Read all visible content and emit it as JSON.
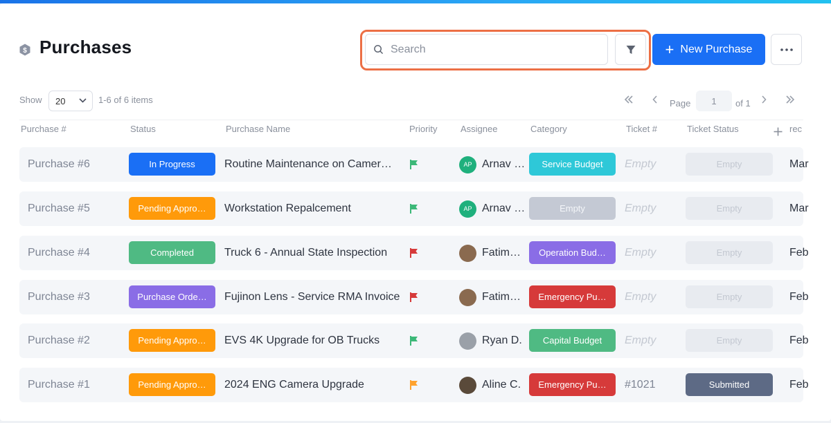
{
  "header": {
    "title": "Purchases",
    "title_icon": "dollar-hexagon-icon",
    "search_placeholder": "Search",
    "new_button_label": "New Purchase",
    "accent_color": "#1a6ff5",
    "highlight_color": "#ec6f45"
  },
  "pagination": {
    "show_label": "Show",
    "page_size": "20",
    "items_count": "1-6 of 6 items",
    "page_label": "Page",
    "current_page": "1",
    "of_label": "of 1"
  },
  "columns": [
    "Purchase #",
    "Status",
    "Purchase Name",
    "Priority",
    "Assignee",
    "Category",
    "Ticket #",
    "Ticket Status",
    "rec"
  ],
  "rows": [
    {
      "number": "Purchase #6",
      "status": "In Progress",
      "status_color": "#1a6ff5",
      "name": "Routine Maintenance on Camer…",
      "priority_color": "#3cb878",
      "avatar": "AP",
      "avatar_color": "#1fb07d",
      "assignee": "Arnav …",
      "category": "Service Budget",
      "category_color": "#2ec8d8",
      "ticket": "Empty",
      "ticket_status": "Empty",
      "last": "Mar"
    },
    {
      "number": "Purchase #5",
      "status": "Pending Appro…",
      "status_color": "#ff9a0a",
      "name": "Workstation Repalcement",
      "priority_color": "#3cb878",
      "avatar": "AP",
      "avatar_color": "#1fb07d",
      "assignee": "Arnav …",
      "category": "Empty",
      "category_color": "#c4c9d4",
      "ticket": "Empty",
      "ticket_status": "Empty",
      "last": "Mar"
    },
    {
      "number": "Purchase #4",
      "status": "Completed",
      "status_color": "#4fba83",
      "name": "Truck 6 - Annual State Inspection",
      "priority_color": "#d63a3a",
      "avatar": "",
      "avatar_color": "#8a6a4f",
      "assignee": "Fatim…",
      "category": "Operation Bud…",
      "category_color": "#8a6de6",
      "ticket": "Empty",
      "ticket_status": "Empty",
      "last": "Feb"
    },
    {
      "number": "Purchase #3",
      "status": "Purchase Orde…",
      "status_color": "#8a6de6",
      "name": "Fujinon Lens - Service RMA Invoice",
      "priority_color": "#d63a3a",
      "avatar": "",
      "avatar_color": "#8a6a4f",
      "assignee": "Fatim…",
      "category": "Emergency Pu…",
      "category_color": "#d63a3a",
      "ticket": "Empty",
      "ticket_status": "Empty",
      "last": "Feb"
    },
    {
      "number": "Purchase #2",
      "status": "Pending Appro…",
      "status_color": "#ff9a0a",
      "name": "EVS 4K Upgrade for OB Trucks",
      "priority_color": "#3cb878",
      "avatar": "",
      "avatar_color": "#9aa0a8",
      "assignee": "Ryan D.",
      "category": "Capital Budget",
      "category_color": "#4fba83",
      "ticket": "Empty",
      "ticket_status": "Empty",
      "last": "Feb"
    },
    {
      "number": "Purchase #1",
      "status": "Pending Appro…",
      "status_color": "#ff9a0a",
      "name": "2024 ENG Camera Upgrade",
      "priority_color": "#ffa22e",
      "avatar": "",
      "avatar_color": "#5a4a3a",
      "assignee": "Aline C.",
      "category": "Emergency Pu…",
      "category_color": "#d63a3a",
      "ticket": "#1021",
      "ticket_status": "Submitted",
      "last": "Feb"
    }
  ]
}
